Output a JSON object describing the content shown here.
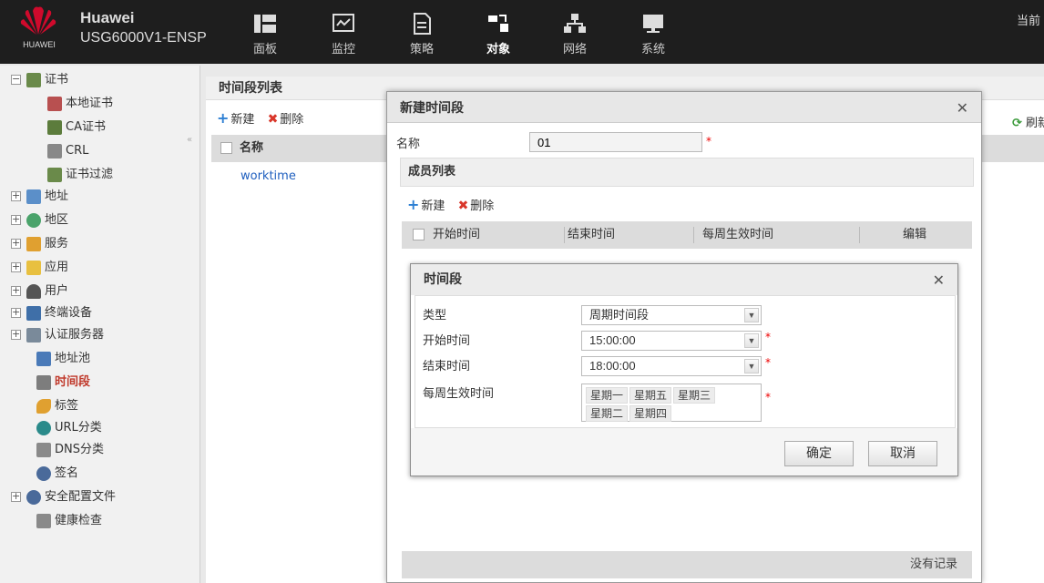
{
  "header": {
    "brand_name": "Huawei",
    "product": "USG6000V1-ENSP",
    "logo_text": "HUAWEI",
    "right_text": "当前",
    "nav": [
      {
        "label": "面板",
        "icon": "dashboard-icon"
      },
      {
        "label": "监控",
        "icon": "monitor-icon"
      },
      {
        "label": "策略",
        "icon": "policy-icon"
      },
      {
        "label": "对象",
        "icon": "object-icon",
        "active": true
      },
      {
        "label": "网络",
        "icon": "network-icon"
      },
      {
        "label": "系统",
        "icon": "system-icon"
      }
    ]
  },
  "sidebar": {
    "items": [
      {
        "label": "证书",
        "icon": "certificate-icon",
        "expander": "−"
      },
      {
        "label": "本地证书",
        "icon": "local-certificate-icon"
      },
      {
        "label": "CA证书",
        "icon": "ca-certificate-icon"
      },
      {
        "label": "CRL",
        "icon": "crl-icon"
      },
      {
        "label": "证书过滤",
        "icon": "certificate-filter-icon"
      },
      {
        "label": "地址",
        "icon": "address-icon",
        "expander": "+"
      },
      {
        "label": "地区",
        "icon": "region-icon",
        "expander": "+"
      },
      {
        "label": "服务",
        "icon": "service-icon",
        "expander": "+"
      },
      {
        "label": "应用",
        "icon": "application-icon",
        "expander": "+"
      },
      {
        "label": "用户",
        "icon": "user-icon",
        "expander": "+"
      },
      {
        "label": "终端设备",
        "icon": "terminal-device-icon",
        "expander": "+"
      },
      {
        "label": "认证服务器",
        "icon": "auth-server-icon",
        "expander": "+"
      },
      {
        "label": "地址池",
        "icon": "address-pool-icon"
      },
      {
        "label": "时间段",
        "icon": "time-range-icon",
        "selected": true
      },
      {
        "label": "标签",
        "icon": "tag-icon"
      },
      {
        "label": "URL分类",
        "icon": "url-category-icon"
      },
      {
        "label": "DNS分类",
        "icon": "dns-category-icon"
      },
      {
        "label": "签名",
        "icon": "signature-icon"
      },
      {
        "label": "安全配置文件",
        "icon": "security-profile-icon",
        "expander": "+"
      },
      {
        "label": "健康检查",
        "icon": "health-check-icon"
      }
    ]
  },
  "main": {
    "title": "时间段列表",
    "new_label": "新建",
    "delete_label": "删除",
    "refresh_label": "刷新",
    "column_name": "名称",
    "rows": [
      "worktime"
    ]
  },
  "dialog_new": {
    "title": "新建时间段",
    "name_label": "名称",
    "name_value": "01",
    "required_mark": "*",
    "members_title": "成员列表",
    "new_label": "新建",
    "delete_label": "删除",
    "columns": [
      "开始时间",
      "结束时间",
      "每周生效时间",
      "编辑"
    ],
    "empty_text": "没有记录"
  },
  "dialog_period": {
    "title": "时间段",
    "type_label": "类型",
    "type_value": "周期时间段",
    "start_label": "开始时间",
    "start_value": "15:00:00",
    "end_label": "结束时间",
    "end_value": "18:00:00",
    "weekdays_label": "每周生效时间",
    "weekdays": [
      "星期一",
      "星期五",
      "星期三",
      "星期二",
      "星期四"
    ],
    "ok_label": "确定",
    "cancel_label": "取消",
    "required_mark": "*"
  },
  "colors": {
    "topbar": "#1e1e1e",
    "selected_item": "#c0392b",
    "link": "#1f5fbf",
    "required": "#e00000",
    "huawei_red": "#cf0a2c"
  }
}
